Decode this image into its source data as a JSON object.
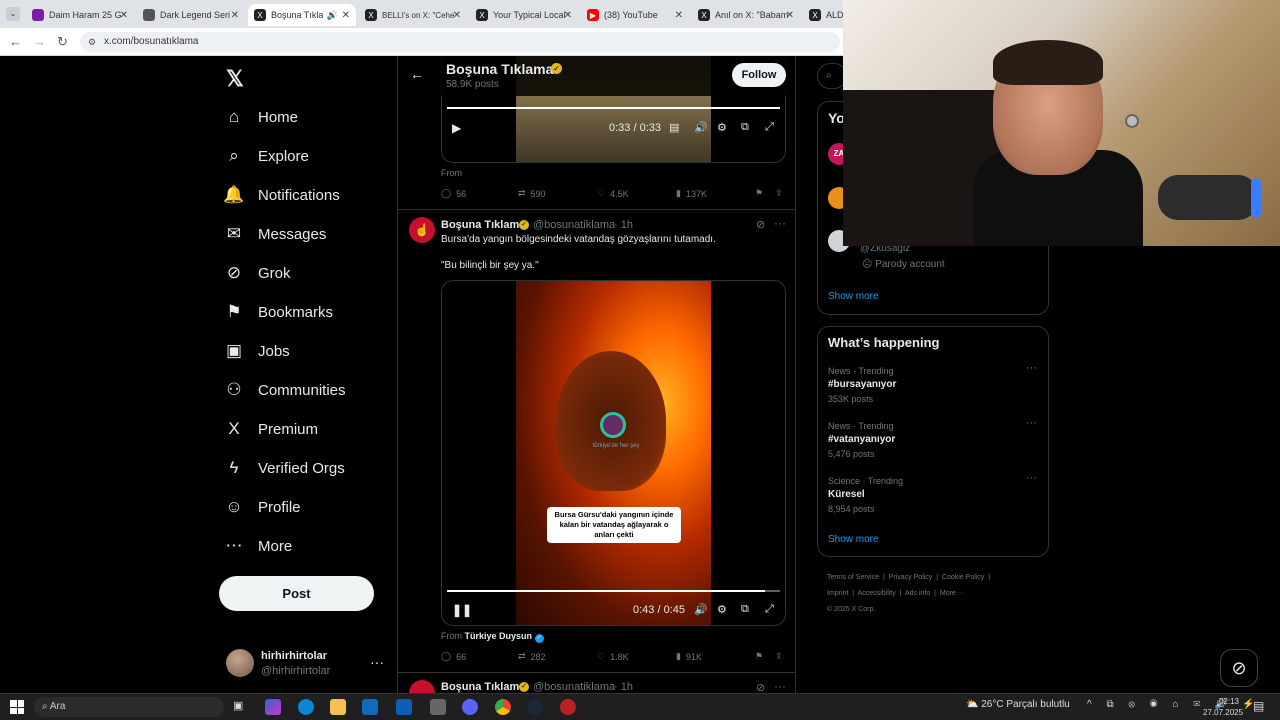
{
  "browser": {
    "tabs": [
      {
        "label": "Daim Haram 25 G",
        "icon": "red",
        "active": false
      },
      {
        "label": "Dark Legend Seri",
        "icon": "doc",
        "active": false
      },
      {
        "label": "Boşuna Tıkla",
        "icon": "X",
        "active": true
      },
      {
        "label": "BELLI's on X: \"Cehe",
        "icon": "X",
        "active": false
      },
      {
        "label": "Your Typical Local",
        "icon": "X",
        "active": false
      },
      {
        "label": "(38) YouTube",
        "icon": "yt",
        "active": false
      },
      {
        "label": "Anıl on X: \"Babam",
        "icon": "X",
        "active": false
      },
      {
        "label": "ALDO",
        "icon": "X",
        "active": false
      }
    ],
    "url": "x.com/bosunatıklama"
  },
  "sidebar": {
    "items": [
      {
        "label": "Home",
        "icon": "⌂"
      },
      {
        "label": "Explore",
        "icon": "⌕"
      },
      {
        "label": "Notifications",
        "icon": "🔔"
      },
      {
        "label": "Messages",
        "icon": "✉"
      },
      {
        "label": "Grok",
        "icon": "⊘"
      },
      {
        "label": "Bookmarks",
        "icon": "⚑"
      },
      {
        "label": "Jobs",
        "icon": "▣"
      },
      {
        "label": "Communities",
        "icon": "⚇"
      },
      {
        "label": "Premium",
        "icon": "X"
      },
      {
        "label": "Verified Orgs",
        "icon": "ϟ"
      },
      {
        "label": "Profile",
        "icon": "☺"
      },
      {
        "label": "More",
        "icon": "⋯"
      }
    ],
    "post_label": "Post",
    "account": {
      "name": "hirhirhirtolar",
      "handle": "@hirhirhirtolar"
    }
  },
  "header": {
    "name": "Boşuna Tıklama",
    "posts": "58.9K posts",
    "follow": "Follow"
  },
  "tweet1": {
    "time": "0:33 / 0:33",
    "from": "From",
    "replies": "56",
    "reposts": "590",
    "likes": "4.5K",
    "views": "137K"
  },
  "tweet2": {
    "name": "Boşuna Tıklama",
    "handle": "@bosunatiklama",
    "time": "· 1h",
    "text": "Bursa'da yangın bölgesindeki vatandaş gözyaşlarını tutamadı.",
    "quote": "\"Bu bilinçli bir şey ya.\"",
    "caption": "Bursa Gürsu'daki yangının içinde kalan bir vatandaş ağlayarak o anları çekti",
    "watermark": "türkiye'de her şey",
    "video_time": "0:43 / 0:45",
    "from_label": "From",
    "from_name": "Türkiye Duysun",
    "replies": "66",
    "reposts": "282",
    "likes": "1.8K",
    "views": "91K"
  },
  "tweet3": {
    "name": "Boşuna Tıklama",
    "handle": "@bosunatiklama",
    "time": "· 1h"
  },
  "right": {
    "who_title": "Yo",
    "follow_handle": "@Zkusagiz",
    "parody": "Parody account",
    "show_more": "Show more",
    "trending_title": "What’s happening",
    "trends": [
      {
        "meta": "News · Trending",
        "tag": "#bursayanıyor",
        "count": "353K posts"
      },
      {
        "meta": "News · Trending",
        "tag": "#vatanyanıyor",
        "count": "5,476 posts"
      },
      {
        "meta": "Science · Trending",
        "tag": "Küresel",
        "count": "8,954 posts"
      }
    ],
    "show_more2": "Show more",
    "footer": [
      "Terms of Service",
      "Privacy Policy",
      "Cookie Policy",
      "Imprint",
      "Accessibility",
      "Ads info",
      "More ···"
    ],
    "copyright": "© 2025 X Corp."
  },
  "taskbar": {
    "search": "Ara",
    "weather": "26°C  Parçalı bulutlu",
    "time": "02:13",
    "date": "27.07.2025"
  },
  "colors": {
    "accent": "#1d9bf0",
    "verified_gold": "#e2b719",
    "bg": "#000000"
  }
}
